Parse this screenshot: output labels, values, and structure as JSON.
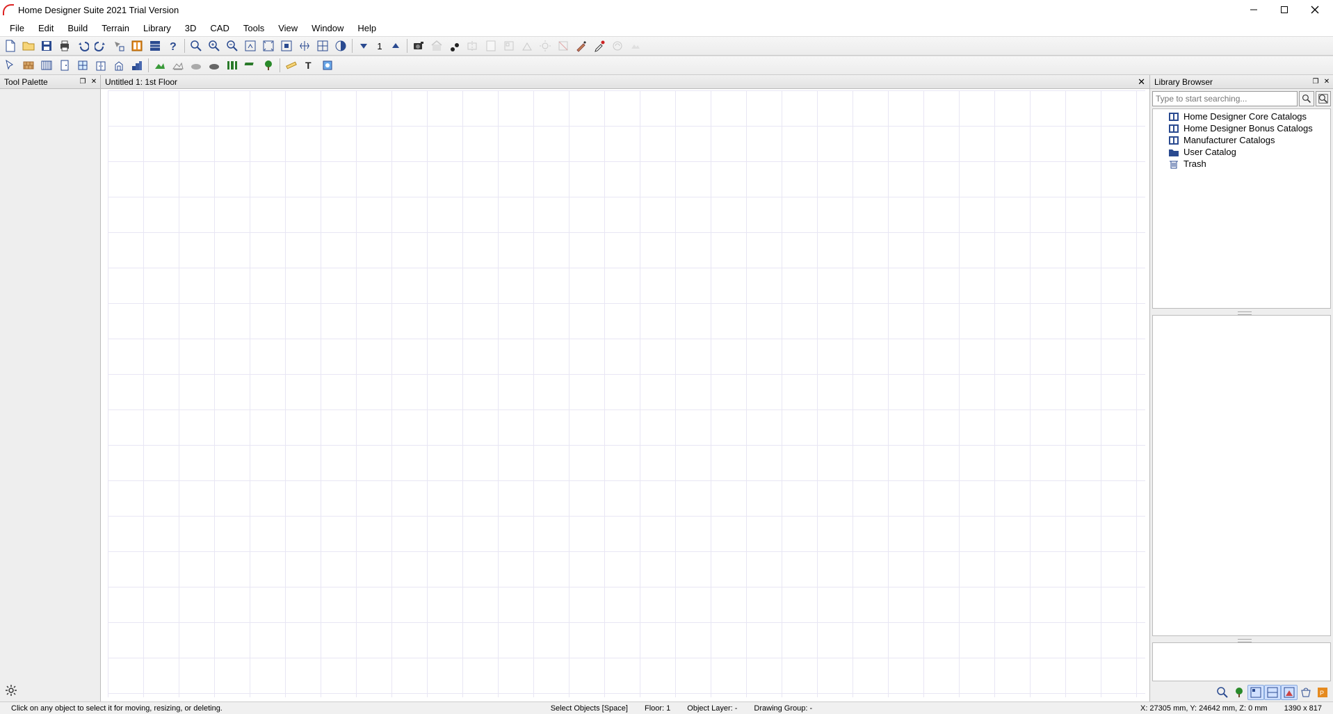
{
  "window": {
    "title": "Home Designer Suite 2021 Trial Version"
  },
  "menu": [
    "File",
    "Edit",
    "Build",
    "Terrain",
    "Library",
    "3D",
    "CAD",
    "Tools",
    "View",
    "Window",
    "Help"
  ],
  "toolbar1": {
    "floor_number": "1"
  },
  "left_panel": {
    "title": "Tool Palette"
  },
  "canvas_tab": {
    "label": "Untitled 1: 1st Floor"
  },
  "library": {
    "title": "Library Browser",
    "search_placeholder": "Type to start searching...",
    "tree": [
      {
        "label": "Home Designer Core Catalogs",
        "icon": "catalog"
      },
      {
        "label": "Home Designer Bonus Catalogs",
        "icon": "catalog"
      },
      {
        "label": "Manufacturer Catalogs",
        "icon": "catalog"
      },
      {
        "label": "User Catalog",
        "icon": "folder"
      },
      {
        "label": "Trash",
        "icon": "trash"
      }
    ]
  },
  "status": {
    "hint": "Click on any object to select it for moving, resizing, or deleting.",
    "tool": "Select Objects [Space]",
    "floor": "Floor: 1",
    "object_layer": "Object Layer: -",
    "drawing_group": "Drawing Group: -",
    "coords": "X: 27305 mm, Y: 24642 mm, Z: 0 mm",
    "pointer": "1390 x 817"
  }
}
